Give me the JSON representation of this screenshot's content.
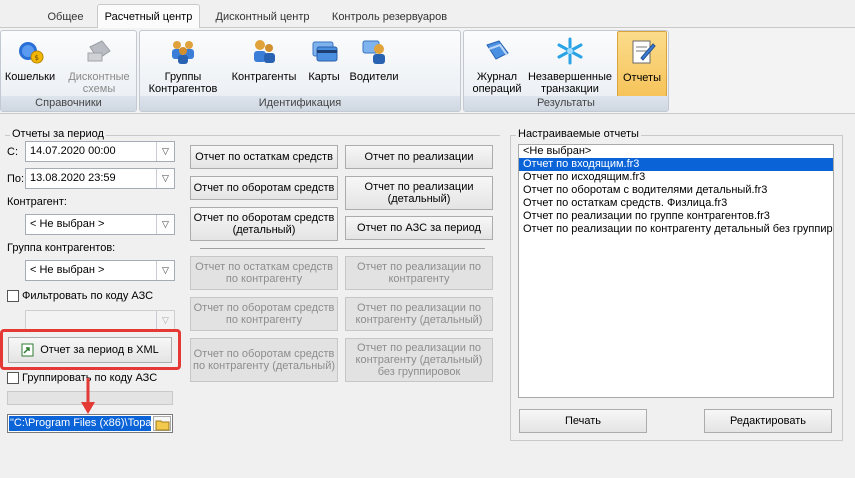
{
  "tabs": [
    "Общее",
    "Расчетный центр",
    "Дисконтный центр",
    "Контроль резервуаров"
  ],
  "ribbon": {
    "spravochniki": {
      "label": "Справочники",
      "wallets": "Кошельки",
      "discount_line1": "Дисконтные",
      "discount_line2": "схемы"
    },
    "identification": {
      "label": "Идентификация",
      "groups_line1": "Группы",
      "groups_line2": "Контрагентов",
      "contractors": "Контрагенты",
      "cards": "Карты",
      "drivers": "Водители"
    },
    "results": {
      "label": "Результаты",
      "journal_line1": "Журнал",
      "journal_line2": "операций",
      "unfinished_line1": "Незавершенные",
      "unfinished_line2": "транзакции",
      "reports": "Отчеты"
    }
  },
  "period": {
    "title": "Отчеты за период",
    "from_label": "С:",
    "from_value": "14.07.2020 00:00",
    "to_label": "По:",
    "to_value": "13.08.2020 23:59",
    "contractor_label": "Контрагент:",
    "contractor_value": "< Не выбран >",
    "group_label": "Группа контрагентов:",
    "group_value": "< Не выбран >",
    "filter_azs": "Фильтровать по коду АЗС",
    "xml_button": "Отчет за период в XML",
    "group_by_azs": "Группировать по коду АЗС",
    "path_value": "\"C:\\Program Files (x86)\\Topa"
  },
  "reports": {
    "stock": "Отчет по остаткам средств",
    "turnover": "Отчет по оборотам средств",
    "turnover_detail_1": "Отчет по оборотам средств",
    "turnover_detail_2": "(детальный)",
    "sales": "Отчет по реализации",
    "sales_detail_1": "Отчет по реализации",
    "sales_detail_2": "(детальный)",
    "azs": "Отчет по АЗС за период",
    "stock_contr_1": "Отчет по остаткам средств",
    "stock_contr_2": "по контрагенту",
    "turn_contr_1": "Отчет по оборотам средств",
    "turn_contr_2": "по контрагенту",
    "turn_contr_det_1": "Отчет по оборотам средств",
    "turn_contr_det_2": "по контрагенту (детальный)",
    "sales_contr_1": "Отчет по реализации по",
    "sales_contr_2": "контрагенту",
    "sales_contr_det_1": "Отчет по реализации по",
    "sales_contr_det_2": "контрагенту (детальный)",
    "sales_contr_nogroup_1": "Отчет по реализации по",
    "sales_contr_nogroup_2": "контрагенту (детальный)",
    "sales_contr_nogroup_3": "без группировок"
  },
  "custom": {
    "title": "Настраиваемые отчеты",
    "items": [
      "<Не выбран>",
      "Отчет по входящим.fr3",
      "Отчет по исходящим.fr3",
      "Отчет по оборотам с водителями детальный.fr3",
      "Отчет по остаткам средств. Физлица.fr3",
      "Отчет по реализации по группе контрагентов.fr3",
      "Отчет по реализации по контрагенту детальный без группир"
    ],
    "selected_index": 1,
    "print": "Печать",
    "edit": "Редактировать"
  },
  "colors": {
    "highlight": "#e53935",
    "selection": "#0a64d8",
    "active_ribbon": "#f6c35a"
  }
}
